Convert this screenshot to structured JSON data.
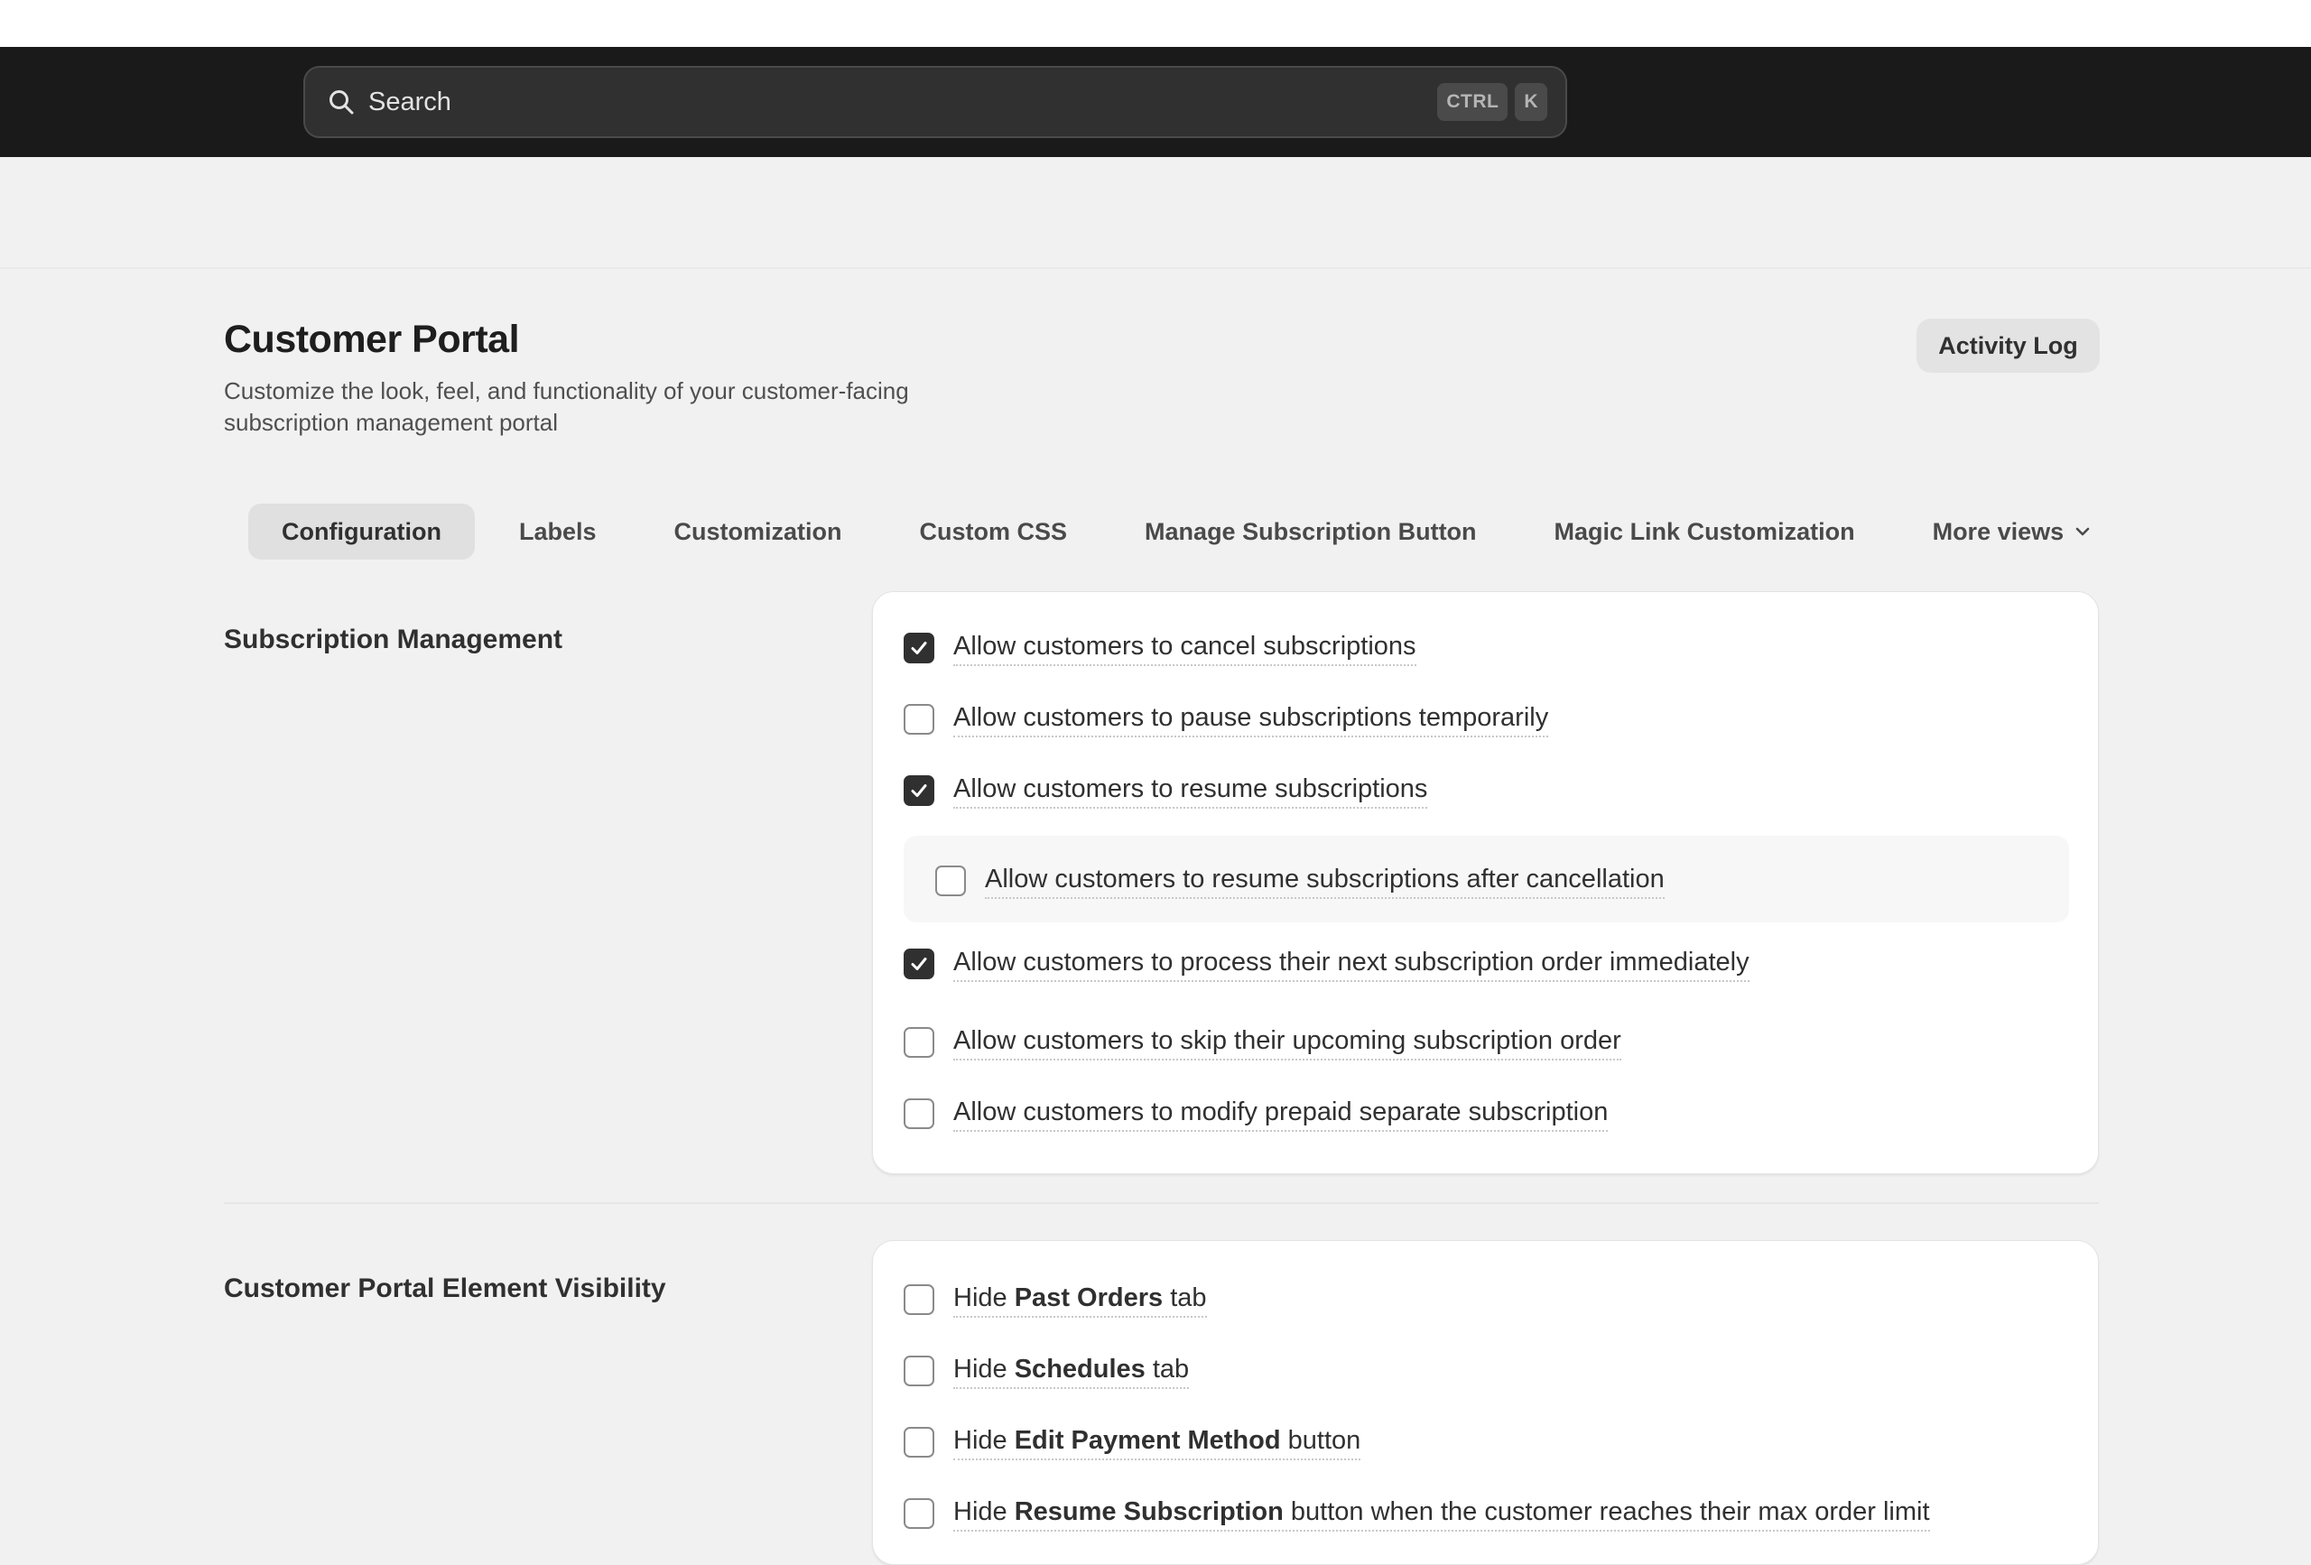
{
  "search": {
    "placeholder": "Search",
    "shortcut_ctrl": "CTRL",
    "shortcut_key": "K"
  },
  "page": {
    "title": "Customer Portal",
    "subtitle": "Customize the look, feel, and functionality of your customer-facing subscription management portal",
    "activity_log_label": "Activity Log"
  },
  "tabs": [
    {
      "label": "Configuration",
      "active": true
    },
    {
      "label": "Labels",
      "active": false
    },
    {
      "label": "Customization",
      "active": false
    },
    {
      "label": "Custom CSS",
      "active": false
    },
    {
      "label": "Manage Subscription Button",
      "active": false
    },
    {
      "label": "Magic Link Customization",
      "active": false
    },
    {
      "label": "More views",
      "active": false
    }
  ],
  "subscription_management": {
    "title": "Subscription Management",
    "options": [
      {
        "label": "Allow customers to cancel subscriptions",
        "checked": true
      },
      {
        "label": "Allow customers to pause subscriptions temporarily",
        "checked": false
      },
      {
        "label": "Allow customers to resume subscriptions",
        "checked": true
      },
      {
        "label": "Allow customers to resume subscriptions after cancellation",
        "checked": false,
        "nested": true
      },
      {
        "label": "Allow customers to process their next subscription order immediately",
        "checked": true
      },
      {
        "label": "Allow customers to skip their upcoming subscription order",
        "checked": false
      },
      {
        "label": "Allow customers to modify prepaid separate subscription",
        "checked": false
      }
    ]
  },
  "element_visibility": {
    "title": "Customer Portal Element Visibility",
    "options": [
      {
        "prefix": "Hide",
        "bold": "Past Orders",
        "suffix": "tab",
        "checked": false
      },
      {
        "prefix": "Hide",
        "bold": "Schedules",
        "suffix": "tab",
        "checked": false
      },
      {
        "prefix": "Hide",
        "bold": "Edit Payment Method",
        "suffix": "button",
        "checked": false
      },
      {
        "prefix": "Hide",
        "bold": "Resume Subscription",
        "suffix": "button when the customer reaches their max order limit",
        "checked": false
      }
    ]
  },
  "colors": {
    "topbar": "#1a1a1a",
    "background": "#f1f1f1",
    "checked_box": "#303030",
    "card": "#ffffff"
  }
}
